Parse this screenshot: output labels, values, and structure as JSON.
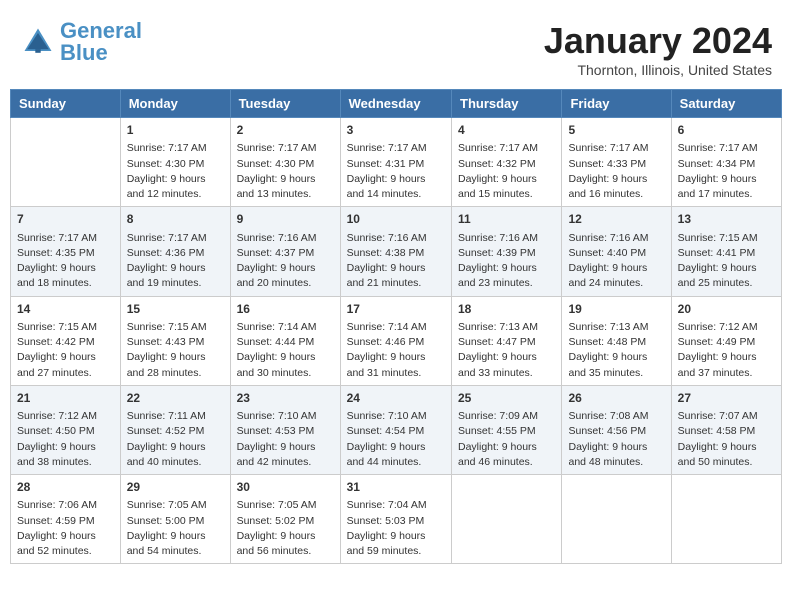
{
  "header": {
    "logo_text_general": "General",
    "logo_text_blue": "Blue",
    "month_title": "January 2024",
    "location": "Thornton, Illinois, United States"
  },
  "weekdays": [
    "Sunday",
    "Monday",
    "Tuesday",
    "Wednesday",
    "Thursday",
    "Friday",
    "Saturday"
  ],
  "weeks": [
    [
      {
        "day": "",
        "empty": true
      },
      {
        "day": "1",
        "sunrise": "7:17 AM",
        "sunset": "4:30 PM",
        "daylight": "9 hours and 12 minutes."
      },
      {
        "day": "2",
        "sunrise": "7:17 AM",
        "sunset": "4:30 PM",
        "daylight": "9 hours and 13 minutes."
      },
      {
        "day": "3",
        "sunrise": "7:17 AM",
        "sunset": "4:31 PM",
        "daylight": "9 hours and 14 minutes."
      },
      {
        "day": "4",
        "sunrise": "7:17 AM",
        "sunset": "4:32 PM",
        "daylight": "9 hours and 15 minutes."
      },
      {
        "day": "5",
        "sunrise": "7:17 AM",
        "sunset": "4:33 PM",
        "daylight": "9 hours and 16 minutes."
      },
      {
        "day": "6",
        "sunrise": "7:17 AM",
        "sunset": "4:34 PM",
        "daylight": "9 hours and 17 minutes."
      }
    ],
    [
      {
        "day": "7",
        "sunrise": "7:17 AM",
        "sunset": "4:35 PM",
        "daylight": "9 hours and 18 minutes."
      },
      {
        "day": "8",
        "sunrise": "7:17 AM",
        "sunset": "4:36 PM",
        "daylight": "9 hours and 19 minutes."
      },
      {
        "day": "9",
        "sunrise": "7:16 AM",
        "sunset": "4:37 PM",
        "daylight": "9 hours and 20 minutes."
      },
      {
        "day": "10",
        "sunrise": "7:16 AM",
        "sunset": "4:38 PM",
        "daylight": "9 hours and 21 minutes."
      },
      {
        "day": "11",
        "sunrise": "7:16 AM",
        "sunset": "4:39 PM",
        "daylight": "9 hours and 23 minutes."
      },
      {
        "day": "12",
        "sunrise": "7:16 AM",
        "sunset": "4:40 PM",
        "daylight": "9 hours and 24 minutes."
      },
      {
        "day": "13",
        "sunrise": "7:15 AM",
        "sunset": "4:41 PM",
        "daylight": "9 hours and 25 minutes."
      }
    ],
    [
      {
        "day": "14",
        "sunrise": "7:15 AM",
        "sunset": "4:42 PM",
        "daylight": "9 hours and 27 minutes."
      },
      {
        "day": "15",
        "sunrise": "7:15 AM",
        "sunset": "4:43 PM",
        "daylight": "9 hours and 28 minutes."
      },
      {
        "day": "16",
        "sunrise": "7:14 AM",
        "sunset": "4:44 PM",
        "daylight": "9 hours and 30 minutes."
      },
      {
        "day": "17",
        "sunrise": "7:14 AM",
        "sunset": "4:46 PM",
        "daylight": "9 hours and 31 minutes."
      },
      {
        "day": "18",
        "sunrise": "7:13 AM",
        "sunset": "4:47 PM",
        "daylight": "9 hours and 33 minutes."
      },
      {
        "day": "19",
        "sunrise": "7:13 AM",
        "sunset": "4:48 PM",
        "daylight": "9 hours and 35 minutes."
      },
      {
        "day": "20",
        "sunrise": "7:12 AM",
        "sunset": "4:49 PM",
        "daylight": "9 hours and 37 minutes."
      }
    ],
    [
      {
        "day": "21",
        "sunrise": "7:12 AM",
        "sunset": "4:50 PM",
        "daylight": "9 hours and 38 minutes."
      },
      {
        "day": "22",
        "sunrise": "7:11 AM",
        "sunset": "4:52 PM",
        "daylight": "9 hours and 40 minutes."
      },
      {
        "day": "23",
        "sunrise": "7:10 AM",
        "sunset": "4:53 PM",
        "daylight": "9 hours and 42 minutes."
      },
      {
        "day": "24",
        "sunrise": "7:10 AM",
        "sunset": "4:54 PM",
        "daylight": "9 hours and 44 minutes."
      },
      {
        "day": "25",
        "sunrise": "7:09 AM",
        "sunset": "4:55 PM",
        "daylight": "9 hours and 46 minutes."
      },
      {
        "day": "26",
        "sunrise": "7:08 AM",
        "sunset": "4:56 PM",
        "daylight": "9 hours and 48 minutes."
      },
      {
        "day": "27",
        "sunrise": "7:07 AM",
        "sunset": "4:58 PM",
        "daylight": "9 hours and 50 minutes."
      }
    ],
    [
      {
        "day": "28",
        "sunrise": "7:06 AM",
        "sunset": "4:59 PM",
        "daylight": "9 hours and 52 minutes."
      },
      {
        "day": "29",
        "sunrise": "7:05 AM",
        "sunset": "5:00 PM",
        "daylight": "9 hours and 54 minutes."
      },
      {
        "day": "30",
        "sunrise": "7:05 AM",
        "sunset": "5:02 PM",
        "daylight": "9 hours and 56 minutes."
      },
      {
        "day": "31",
        "sunrise": "7:04 AM",
        "sunset": "5:03 PM",
        "daylight": "9 hours and 59 minutes."
      },
      {
        "day": "",
        "empty": true
      },
      {
        "day": "",
        "empty": true
      },
      {
        "day": "",
        "empty": true
      }
    ]
  ],
  "labels": {
    "sunrise_label": "Sunrise:",
    "sunset_label": "Sunset:",
    "daylight_label": "Daylight:"
  }
}
